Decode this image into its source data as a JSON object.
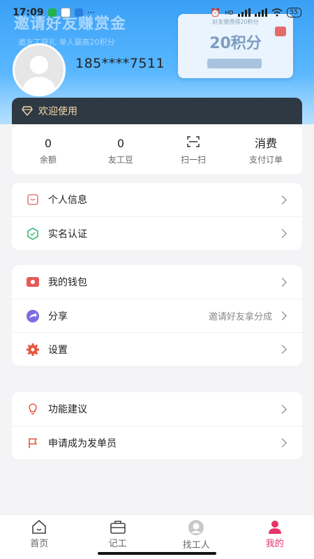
{
  "status_bar": {
    "time": "17:09",
    "network": "HD",
    "battery": "55"
  },
  "banner": {
    "title": "邀请好友赚赏金",
    "subtitle": "邀友工获礼 单人最高20积分",
    "card_top": "好友使用得20积分",
    "card_main": "20积分"
  },
  "profile": {
    "phone": "185****7511"
  },
  "welcome": {
    "label": "欢迎使用"
  },
  "stats": [
    {
      "value": "0",
      "label": "余额"
    },
    {
      "value": "0",
      "label": "友工豆"
    },
    {
      "value": "",
      "label": "扫一扫",
      "icon": "scan-icon"
    },
    {
      "value": "消费",
      "label": "支付订单"
    }
  ],
  "group1": [
    {
      "label": "个人信息",
      "icon": "profile-card-icon"
    },
    {
      "label": "实名认证",
      "icon": "verify-shield-icon"
    }
  ],
  "group2": [
    {
      "label": "我的钱包",
      "icon": "wallet-icon"
    },
    {
      "label": "分享",
      "icon": "share-icon",
      "extra": "邀请好友拿分成"
    },
    {
      "label": "设置",
      "icon": "gear-icon"
    }
  ],
  "group3": [
    {
      "label": "功能建议",
      "icon": "lightbulb-icon"
    },
    {
      "label": "申请成为发单员",
      "icon": "flag-icon"
    }
  ],
  "tabs": [
    {
      "label": "首页",
      "icon": "home-icon",
      "active": false
    },
    {
      "label": "记工",
      "icon": "briefcase-icon",
      "active": false
    },
    {
      "label": "找工人",
      "icon": "worker-avatar-icon",
      "active": false
    },
    {
      "label": "我的",
      "icon": "user-icon",
      "active": true
    }
  ],
  "colors": {
    "accent": "#e6336a",
    "header_blue": "#3aa0f5",
    "welcome_bg": "#2f3943",
    "welcome_text": "#f5d9a8"
  }
}
